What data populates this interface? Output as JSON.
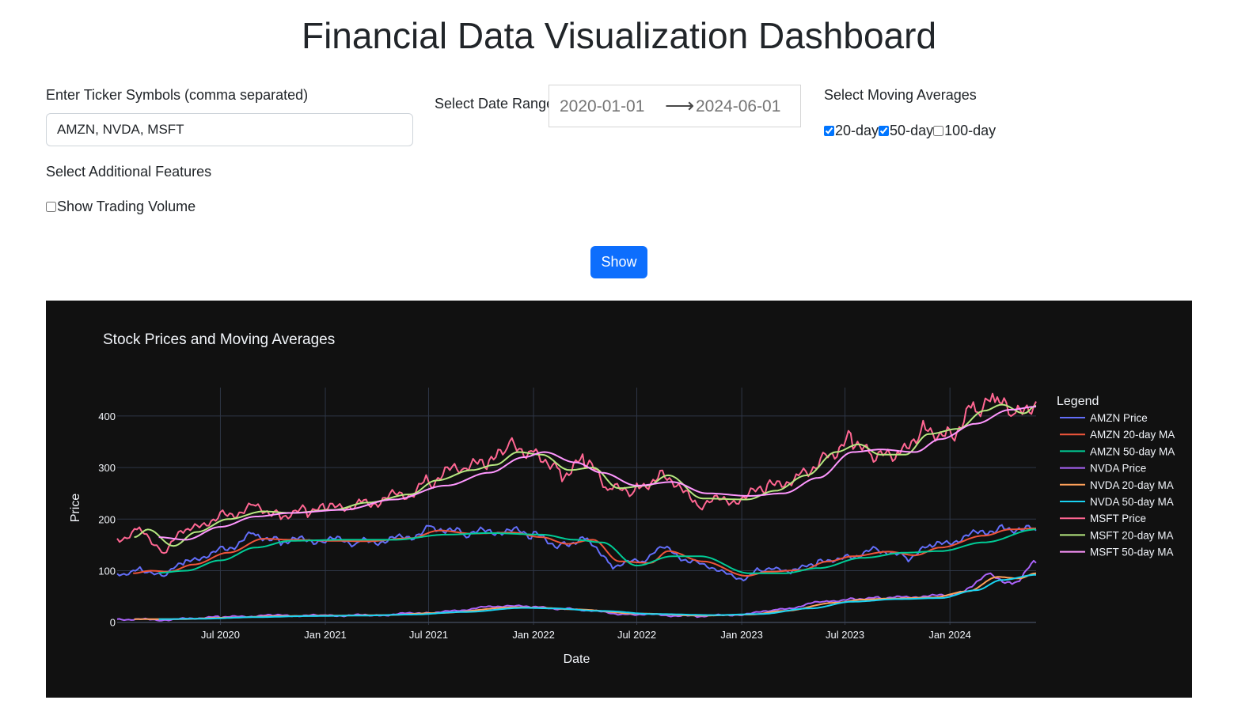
{
  "page": {
    "title": "Financial Data Visualization Dashboard"
  },
  "tickers": {
    "label": "Enter Ticker Symbols (comma separated)",
    "value": "AMZN, NVDA, MSFT"
  },
  "date_range": {
    "label": "Select Date Range",
    "start": "2020-01-01",
    "end": "2024-06-01",
    "arrow_icon": "arrow-right-icon"
  },
  "moving_averages": {
    "label": "Select Moving Averages",
    "options": [
      {
        "label": "20-day",
        "checked": true
      },
      {
        "label": "50-day",
        "checked": true
      },
      {
        "label": "100-day",
        "checked": false
      }
    ]
  },
  "features": {
    "label": "Select Additional Features",
    "options": [
      {
        "label": "Show Trading Volume",
        "checked": false
      }
    ]
  },
  "actions": {
    "show_label": "Show"
  },
  "colors": {
    "accent": "#0d6efd",
    "chart_bg": "#111111",
    "grid": "#2e3646",
    "axis_text": "#f2f5fa"
  },
  "chart_data": {
    "type": "line",
    "title": "Stock Prices and Moving Averages",
    "xlabel": "Date",
    "ylabel": "Price",
    "legend_title": "Legend",
    "legend_position": "right",
    "grid": true,
    "xlim": [
      "2020-01-02",
      "2024-05-31"
    ],
    "ylim": [
      -5,
      455
    ],
    "x_ticks": [
      {
        "date": "2020-07-01",
        "label": "Jul 2020"
      },
      {
        "date": "2021-01-01",
        "label": "Jan 2021"
      },
      {
        "date": "2021-07-01",
        "label": "Jul 2021"
      },
      {
        "date": "2022-01-01",
        "label": "Jan 2022"
      },
      {
        "date": "2022-07-01",
        "label": "Jul 2022"
      },
      {
        "date": "2023-01-01",
        "label": "Jan 2023"
      },
      {
        "date": "2023-07-01",
        "label": "Jul 2023"
      },
      {
        "date": "2024-01-01",
        "label": "Jan 2024"
      }
    ],
    "y_ticks": [
      0,
      100,
      200,
      300,
      400
    ],
    "series": [
      {
        "name": "AMZN Price",
        "color": "#636efa",
        "points": [
          [
            "2020-01-02",
            94
          ],
          [
            "2020-02-15",
            102
          ],
          [
            "2020-03-20",
            90
          ],
          [
            "2020-05-01",
            115
          ],
          [
            "2020-07-01",
            140
          ],
          [
            "2020-09-01",
            170
          ],
          [
            "2020-10-15",
            158
          ],
          [
            "2021-01-01",
            160
          ],
          [
            "2021-03-01",
            155
          ],
          [
            "2021-05-15",
            162
          ],
          [
            "2021-07-10",
            185
          ],
          [
            "2021-09-01",
            172
          ],
          [
            "2021-11-15",
            178
          ],
          [
            "2022-01-01",
            168
          ],
          [
            "2022-02-20",
            150
          ],
          [
            "2022-04-01",
            165
          ],
          [
            "2022-05-20",
            110
          ],
          [
            "2022-07-15",
            120
          ],
          [
            "2022-08-15",
            142
          ],
          [
            "2022-10-15",
            115
          ],
          [
            "2022-12-31",
            85
          ],
          [
            "2023-02-01",
            102
          ],
          [
            "2023-04-01",
            100
          ],
          [
            "2023-05-15",
            115
          ],
          [
            "2023-07-01",
            128
          ],
          [
            "2023-09-01",
            140
          ],
          [
            "2023-10-20",
            125
          ],
          [
            "2023-12-01",
            147
          ],
          [
            "2024-02-15",
            170
          ],
          [
            "2024-04-01",
            185
          ],
          [
            "2024-05-31",
            178
          ]
        ]
      },
      {
        "name": "AMZN 20-day MA",
        "color": "#ef553b",
        "points": [
          [
            "2020-01-30",
            95
          ],
          [
            "2020-03-01",
            100
          ],
          [
            "2020-04-01",
            98
          ],
          [
            "2020-05-15",
            112
          ],
          [
            "2020-07-15",
            135
          ],
          [
            "2020-09-15",
            162
          ],
          [
            "2020-11-01",
            160
          ],
          [
            "2021-01-15",
            158
          ],
          [
            "2021-03-15",
            157
          ],
          [
            "2021-05-30",
            163
          ],
          [
            "2021-07-20",
            178
          ],
          [
            "2021-09-15",
            172
          ],
          [
            "2021-11-25",
            174
          ],
          [
            "2022-01-15",
            165
          ],
          [
            "2022-03-01",
            152
          ],
          [
            "2022-04-15",
            160
          ],
          [
            "2022-06-01",
            118
          ],
          [
            "2022-07-25",
            115
          ],
          [
            "2022-08-25",
            138
          ],
          [
            "2022-10-25",
            118
          ],
          [
            "2023-01-10",
            90
          ],
          [
            "2023-02-15",
            98
          ],
          [
            "2023-04-15",
            101
          ],
          [
            "2023-06-01",
            118
          ],
          [
            "2023-07-15",
            128
          ],
          [
            "2023-09-15",
            137
          ],
          [
            "2023-11-01",
            130
          ],
          [
            "2023-12-15",
            145
          ],
          [
            "2024-03-01",
            168
          ],
          [
            "2024-04-15",
            180
          ],
          [
            "2024-05-31",
            182
          ]
        ]
      },
      {
        "name": "AMZN 50-day MA",
        "color": "#00cc96",
        "points": [
          [
            "2020-03-15",
            96
          ],
          [
            "2020-05-01",
            100
          ],
          [
            "2020-07-01",
            120
          ],
          [
            "2020-09-01",
            145
          ],
          [
            "2020-11-01",
            158
          ],
          [
            "2021-02-01",
            160
          ],
          [
            "2021-05-01",
            160
          ],
          [
            "2021-08-01",
            170
          ],
          [
            "2021-10-15",
            173
          ],
          [
            "2022-01-15",
            170
          ],
          [
            "2022-03-15",
            160
          ],
          [
            "2022-05-01",
            155
          ],
          [
            "2022-07-01",
            110
          ],
          [
            "2022-09-01",
            128
          ],
          [
            "2022-10-20",
            128
          ],
          [
            "2023-01-15",
            95
          ],
          [
            "2023-03-15",
            95
          ],
          [
            "2023-05-15",
            105
          ],
          [
            "2023-08-01",
            125
          ],
          [
            "2023-10-15",
            135
          ],
          [
            "2023-12-15",
            138
          ],
          [
            "2024-03-01",
            155
          ],
          [
            "2024-05-31",
            180
          ]
        ]
      },
      {
        "name": "NVDA Price",
        "color": "#ab63fa",
        "points": [
          [
            "2020-01-02",
            6
          ],
          [
            "2020-03-20",
            5
          ],
          [
            "2020-07-01",
            10
          ],
          [
            "2020-10-01",
            13
          ],
          [
            "2021-01-01",
            13
          ],
          [
            "2021-04-01",
            14
          ],
          [
            "2021-07-01",
            19
          ],
          [
            "2021-11-20",
            32
          ],
          [
            "2022-01-01",
            29
          ],
          [
            "2022-03-01",
            26
          ],
          [
            "2022-06-15",
            16
          ],
          [
            "2022-10-15",
            12
          ],
          [
            "2023-01-01",
            15
          ],
          [
            "2023-03-01",
            24
          ],
          [
            "2023-05-30",
            40
          ],
          [
            "2023-07-15",
            46
          ],
          [
            "2023-09-01",
            47
          ],
          [
            "2023-11-15",
            50
          ],
          [
            "2024-01-15",
            55
          ],
          [
            "2024-03-08",
            92
          ],
          [
            "2024-04-19",
            77
          ],
          [
            "2024-05-31",
            115
          ]
        ]
      },
      {
        "name": "NVDA 20-day MA",
        "color": "#ffa15a",
        "points": [
          [
            "2020-02-01",
            6
          ],
          [
            "2020-04-15",
            6
          ],
          [
            "2020-07-15",
            9
          ],
          [
            "2020-10-15",
            12
          ],
          [
            "2021-01-15",
            13
          ],
          [
            "2021-04-15",
            14
          ],
          [
            "2021-07-15",
            18
          ],
          [
            "2021-12-01",
            29
          ],
          [
            "2022-01-15",
            28
          ],
          [
            "2022-03-15",
            25
          ],
          [
            "2022-07-01",
            17
          ],
          [
            "2022-10-25",
            13
          ],
          [
            "2023-01-15",
            15
          ],
          [
            "2023-03-15",
            22
          ],
          [
            "2023-06-15",
            38
          ],
          [
            "2023-08-01",
            44
          ],
          [
            "2023-09-15",
            46
          ],
          [
            "2023-12-01",
            48
          ],
          [
            "2024-02-01",
            60
          ],
          [
            "2024-03-25",
            88
          ],
          [
            "2024-05-01",
            85
          ],
          [
            "2024-05-31",
            95
          ]
        ]
      },
      {
        "name": "NVDA 50-day MA",
        "color": "#19d3f3",
        "points": [
          [
            "2020-03-15",
            6
          ],
          [
            "2020-06-01",
            7
          ],
          [
            "2020-09-01",
            10
          ],
          [
            "2020-12-01",
            12
          ],
          [
            "2021-03-01",
            13
          ],
          [
            "2021-06-01",
            15
          ],
          [
            "2021-09-01",
            20
          ],
          [
            "2021-12-15",
            28
          ],
          [
            "2022-02-01",
            27
          ],
          [
            "2022-05-01",
            22
          ],
          [
            "2022-08-01",
            16
          ],
          [
            "2022-11-15",
            14
          ],
          [
            "2023-02-01",
            16
          ],
          [
            "2023-05-01",
            27
          ],
          [
            "2023-07-15",
            40
          ],
          [
            "2023-10-01",
            45
          ],
          [
            "2023-12-15",
            47
          ],
          [
            "2024-02-15",
            62
          ],
          [
            "2024-04-01",
            82
          ],
          [
            "2024-05-31",
            92
          ]
        ]
      },
      {
        "name": "MSFT Price",
        "color": "#ff6692",
        "points": [
          [
            "2020-01-02",
            158
          ],
          [
            "2020-02-10",
            185
          ],
          [
            "2020-03-20",
            137
          ],
          [
            "2020-05-01",
            175
          ],
          [
            "2020-07-01",
            205
          ],
          [
            "2020-09-01",
            225
          ],
          [
            "2020-10-15",
            210
          ],
          [
            "2020-12-01",
            215
          ],
          [
            "2021-01-01",
            218
          ],
          [
            "2021-03-01",
            230
          ],
          [
            "2021-05-15",
            245
          ],
          [
            "2021-07-01",
            275
          ],
          [
            "2021-09-01",
            300
          ],
          [
            "2021-10-15",
            305
          ],
          [
            "2021-11-20",
            340
          ],
          [
            "2022-01-01",
            335
          ],
          [
            "2022-02-20",
            290
          ],
          [
            "2022-04-01",
            310
          ],
          [
            "2022-05-15",
            255
          ],
          [
            "2022-07-01",
            258
          ],
          [
            "2022-08-15",
            290
          ],
          [
            "2022-10-15",
            230
          ],
          [
            "2022-12-31",
            240
          ],
          [
            "2023-02-15",
            260
          ],
          [
            "2023-04-15",
            285
          ],
          [
            "2023-06-01",
            330
          ],
          [
            "2023-07-15",
            355
          ],
          [
            "2023-08-20",
            318
          ],
          [
            "2023-10-01",
            320
          ],
          [
            "2023-11-15",
            375
          ],
          [
            "2024-01-01",
            370
          ],
          [
            "2024-02-15",
            415
          ],
          [
            "2024-03-20",
            425
          ],
          [
            "2024-04-25",
            395
          ],
          [
            "2024-05-31",
            428
          ]
        ]
      },
      {
        "name": "MSFT 20-day MA",
        "color": "#b6e880",
        "points": [
          [
            "2020-02-01",
            165
          ],
          [
            "2020-02-25",
            180
          ],
          [
            "2020-04-10",
            148
          ],
          [
            "2020-05-20",
            175
          ],
          [
            "2020-07-15",
            200
          ],
          [
            "2020-09-15",
            215
          ],
          [
            "2020-11-01",
            212
          ],
          [
            "2021-01-15",
            218
          ],
          [
            "2021-03-15",
            232
          ],
          [
            "2021-05-30",
            248
          ],
          [
            "2021-07-15",
            275
          ],
          [
            "2021-09-15",
            295
          ],
          [
            "2021-10-25",
            305
          ],
          [
            "2021-12-05",
            330
          ],
          [
            "2022-01-15",
            325
          ],
          [
            "2022-03-05",
            295
          ],
          [
            "2022-04-15",
            300
          ],
          [
            "2022-05-30",
            260
          ],
          [
            "2022-07-20",
            265
          ],
          [
            "2022-08-25",
            285
          ],
          [
            "2022-10-25",
            240
          ],
          [
            "2023-01-10",
            238
          ],
          [
            "2023-03-01",
            255
          ],
          [
            "2023-04-25",
            285
          ],
          [
            "2023-06-15",
            330
          ],
          [
            "2023-07-25",
            345
          ],
          [
            "2023-09-01",
            325
          ],
          [
            "2023-10-15",
            325
          ],
          [
            "2023-11-25",
            365
          ],
          [
            "2024-01-15",
            375
          ],
          [
            "2024-03-01",
            410
          ],
          [
            "2024-04-01",
            422
          ],
          [
            "2024-05-10",
            405
          ],
          [
            "2024-05-31",
            420
          ]
        ]
      },
      {
        "name": "MSFT 50-day MA",
        "color": "#ff97ff",
        "points": [
          [
            "2020-03-15",
            165
          ],
          [
            "2020-05-01",
            160
          ],
          [
            "2020-07-01",
            185
          ],
          [
            "2020-09-01",
            205
          ],
          [
            "2020-11-01",
            212
          ],
          [
            "2021-02-01",
            218
          ],
          [
            "2021-05-01",
            238
          ],
          [
            "2021-08-01",
            265
          ],
          [
            "2021-10-15",
            290
          ],
          [
            "2021-12-15",
            320
          ],
          [
            "2022-01-20",
            330
          ],
          [
            "2022-03-15",
            310
          ],
          [
            "2022-05-01",
            290
          ],
          [
            "2022-07-01",
            265
          ],
          [
            "2022-09-01",
            272
          ],
          [
            "2022-11-01",
            250
          ],
          [
            "2023-01-15",
            245
          ],
          [
            "2023-03-15",
            250
          ],
          [
            "2023-05-15",
            280
          ],
          [
            "2023-07-15",
            330
          ],
          [
            "2023-09-01",
            335
          ],
          [
            "2023-11-01",
            330
          ],
          [
            "2023-12-15",
            355
          ],
          [
            "2024-02-15",
            385
          ],
          [
            "2024-04-15",
            412
          ],
          [
            "2024-05-31",
            418
          ]
        ]
      }
    ]
  }
}
